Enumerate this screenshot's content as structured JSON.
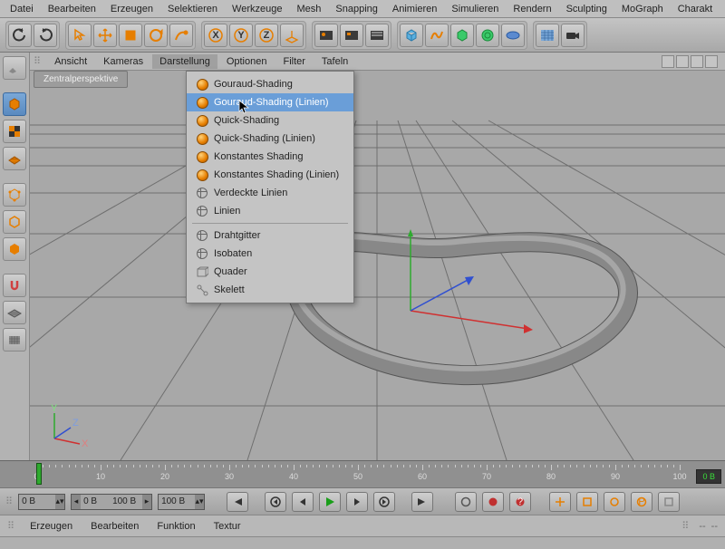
{
  "menubar": [
    "Datei",
    "Bearbeiten",
    "Erzeugen",
    "Selektieren",
    "Werkzeuge",
    "Mesh",
    "Snapping",
    "Animieren",
    "Simulieren",
    "Rendern",
    "Sculpting",
    "MoGraph",
    "Charakt"
  ],
  "viewport_menubar": [
    "Ansicht",
    "Kameras",
    "Darstellung",
    "Optionen",
    "Filter",
    "Tafeln"
  ],
  "viewport_tab": "Zentralperspektive",
  "display_menu": {
    "group1": [
      "Gouraud-Shading",
      "Gouraud-Shading (Linien)",
      "Quick-Shading",
      "Quick-Shading (Linien)",
      "Konstantes Shading",
      "Konstantes Shading (Linien)",
      "Verdeckte Linien",
      "Linien"
    ],
    "group2": [
      "Drahtgitter",
      "Isobaten",
      "Quader",
      "Skelett"
    ],
    "highlighted_index": 1
  },
  "timeline": {
    "ticks": [
      0,
      10,
      20,
      30,
      40,
      50,
      60,
      70,
      80,
      90,
      100
    ],
    "current_label": "0 B"
  },
  "transport": {
    "field1": "0 B",
    "range_start": "0 B",
    "range_end": "100 B",
    "field2": "100 B"
  },
  "bottom_menu": [
    "Erzeugen",
    "Bearbeiten",
    "Funktion",
    "Textur"
  ],
  "bottom_empty": "--",
  "axis": {
    "x": "X",
    "y": "Y",
    "z": "Z"
  }
}
